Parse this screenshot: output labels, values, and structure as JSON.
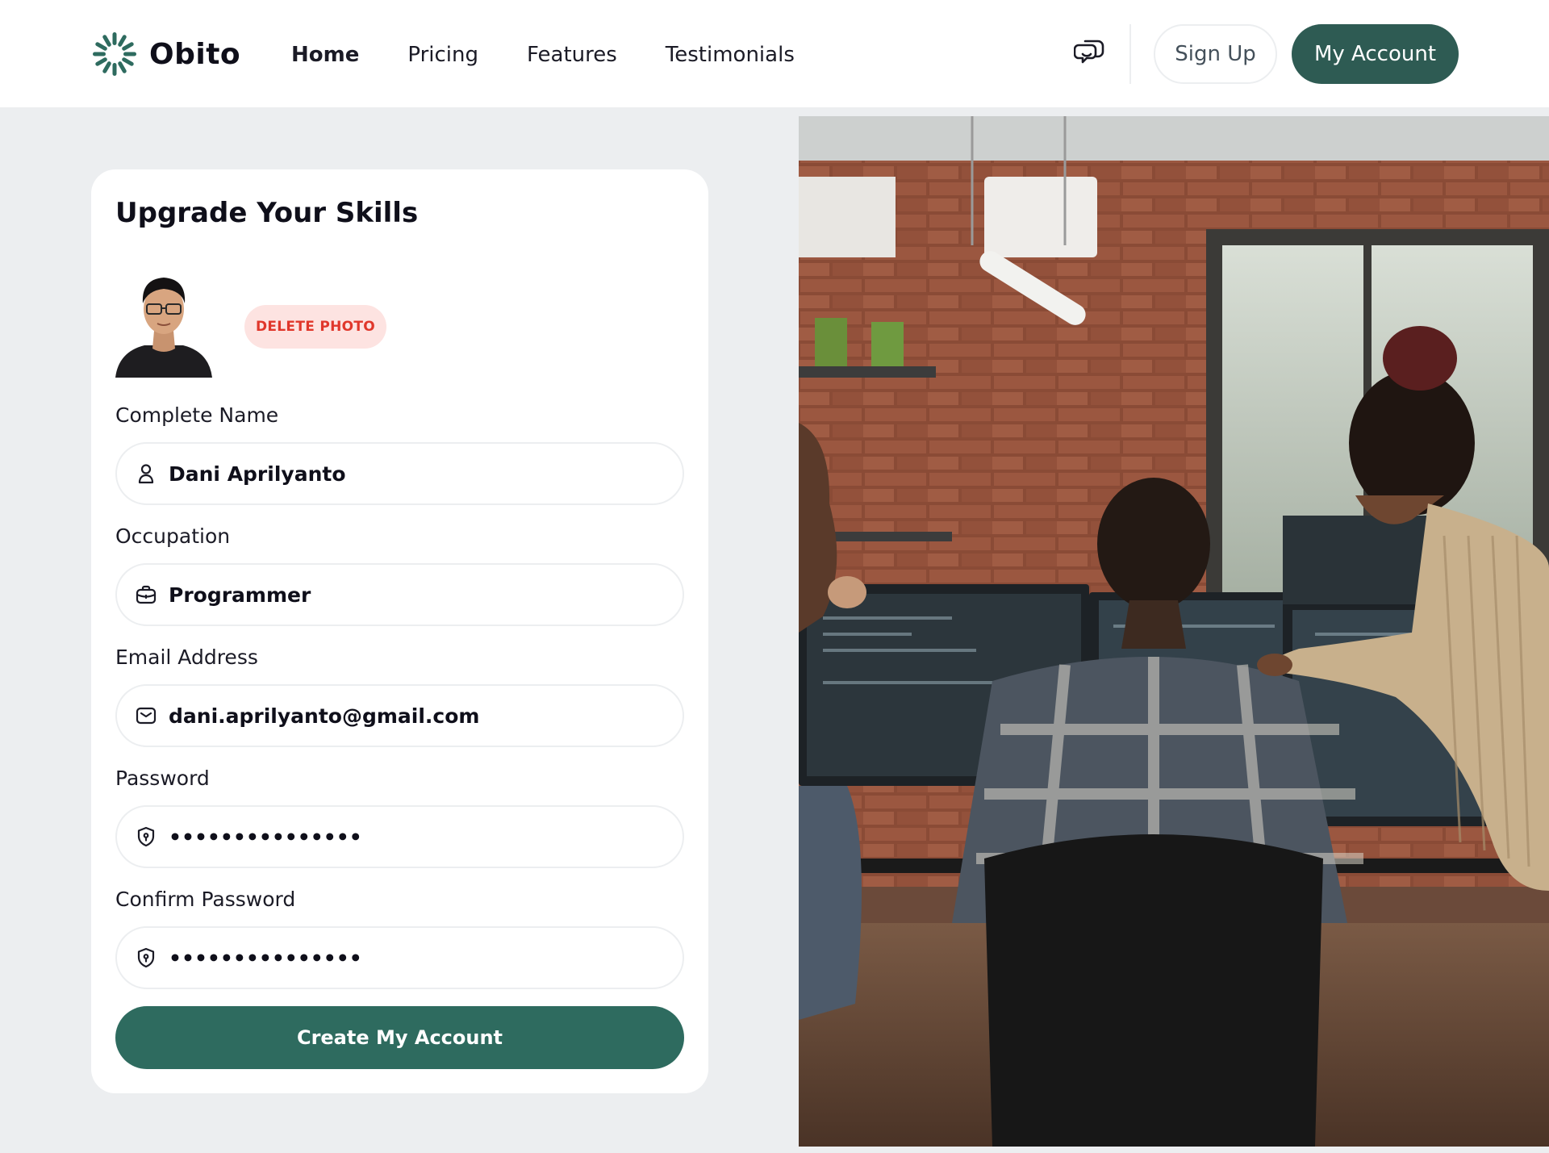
{
  "brand": {
    "name": "Obito",
    "accent": "#2e6b5f",
    "primary_dark": "#2e5b53"
  },
  "nav": {
    "items": [
      {
        "label": "Home",
        "active": true
      },
      {
        "label": "Pricing",
        "active": false
      },
      {
        "label": "Features",
        "active": false
      },
      {
        "label": "Testimonials",
        "active": false
      }
    ]
  },
  "header": {
    "chat_icon": "chat-bubbles-icon",
    "signup_label": "Sign Up",
    "account_label": "My Account"
  },
  "form": {
    "title": "Upgrade Your Skills",
    "delete_photo_label": "DELETE PHOTO",
    "fields": [
      {
        "label": "Complete Name",
        "value": "Dani Aprilyanto",
        "icon": "user-icon",
        "type": "text"
      },
      {
        "label": "Occupation",
        "value": "Programmer",
        "icon": "briefcase-icon",
        "type": "text"
      },
      {
        "label": "Email Address",
        "value": "dani.aprilyanto@gmail.com",
        "icon": "mail-icon",
        "type": "email"
      },
      {
        "label": "Password",
        "value": "•••••••••••••••",
        "icon": "shield-icon",
        "type": "password"
      },
      {
        "label": "Confirm Password",
        "value": "•••••••••••••••",
        "icon": "shield-icon",
        "type": "password"
      }
    ],
    "submit_label": "Create My Account"
  }
}
